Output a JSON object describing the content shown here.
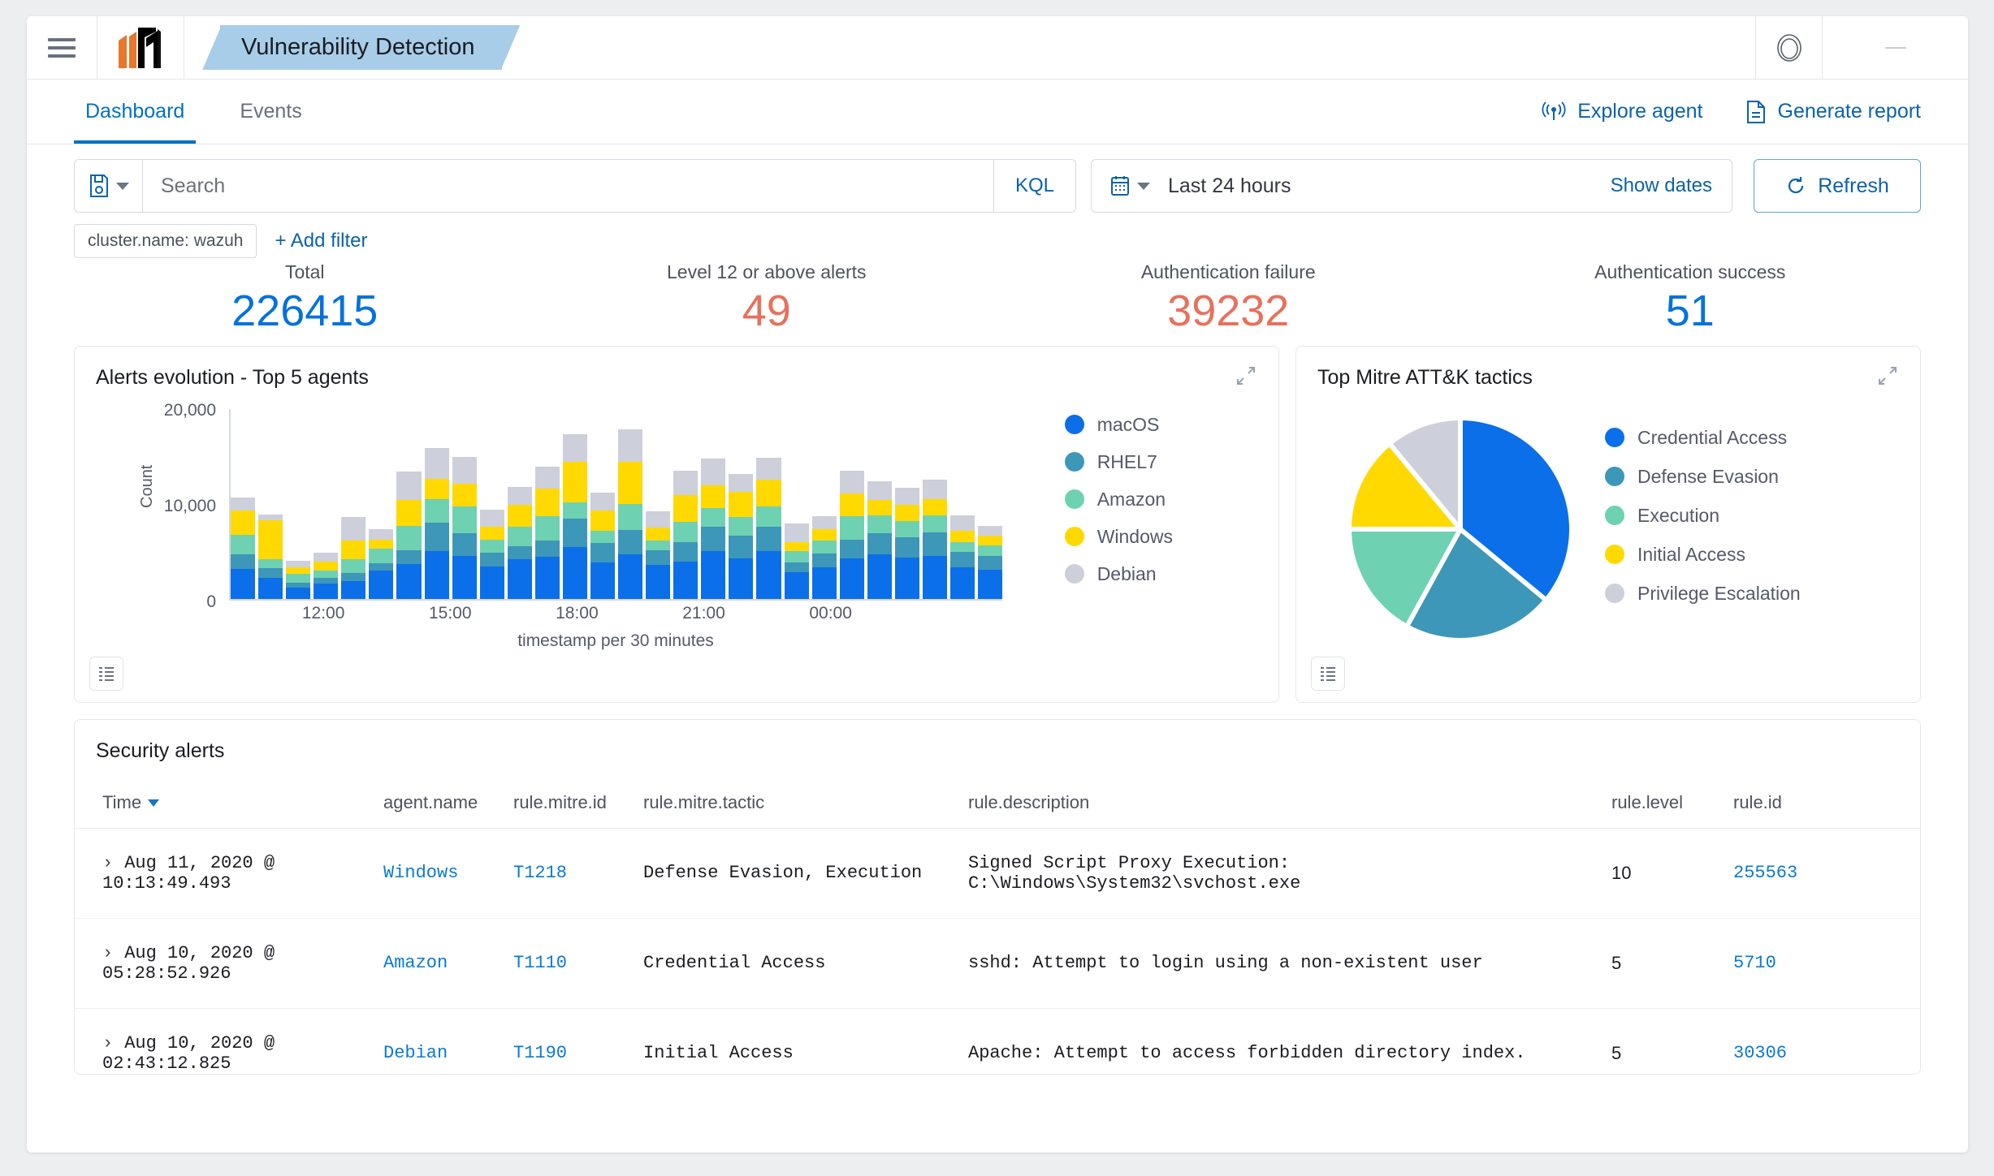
{
  "header": {
    "app_title": "Vulnerability Detection",
    "menu_icon": "hamburger-menu-icon",
    "logo_icon": "wazuh-logo-icon",
    "account_icon": "account-circle-icon"
  },
  "nav": {
    "tabs": [
      {
        "label": "Dashboard",
        "active": true
      },
      {
        "label": "Events",
        "active": false
      }
    ],
    "actions": [
      {
        "label": "Explore agent",
        "icon": "agent-signal-icon"
      },
      {
        "label": "Generate report",
        "icon": "document-report-icon"
      }
    ]
  },
  "search": {
    "placeholder": "Search",
    "value": "",
    "dataview_icon": "saved-query-icon",
    "language": "KQL",
    "date_icon": "calendar-icon",
    "date_range": "Last 24 hours",
    "show_dates": "Show dates",
    "refresh": "Refresh",
    "refresh_icon": "refresh-icon"
  },
  "filters": {
    "pills": [
      "cluster.name: wazuh"
    ],
    "add_filter": "+ Add filter"
  },
  "kpis": [
    {
      "label": "Total",
      "value": "226415",
      "color": "blue"
    },
    {
      "label": "Level 12 or above alerts",
      "value": "49",
      "color": "red"
    },
    {
      "label": "Authentication failure",
      "value": "39232",
      "color": "red"
    },
    {
      "label": "Authentication success",
      "value": "51",
      "color": "blue"
    }
  ],
  "panels": {
    "bar": {
      "title": "Alerts evolution - Top 5 agents",
      "expand_icon": "expand-icon",
      "footer_icon": "inspect-data-icon"
    },
    "pie": {
      "title": "Top Mitre ATT&K tactics",
      "expand_icon": "expand-icon",
      "footer_icon": "inspect-data-icon"
    }
  },
  "chart_data": [
    {
      "type": "bar",
      "title": "Alerts evolution - Top 5 agents",
      "xlabel": "timestamp per 30 minutes",
      "ylabel": "Count",
      "ylim": [
        0,
        20000
      ],
      "yticks": [
        "0",
        "10,000",
        "20,000"
      ],
      "xticks": [
        "12:00",
        "15:00",
        "18:00",
        "21:00",
        "00:00"
      ],
      "xtick_positions_pct": [
        12.2,
        28.6,
        45.0,
        61.4,
        77.8
      ],
      "grid": false,
      "legend_position": "right",
      "stacked": true,
      "colors": {
        "macOS": "#0a6fe8",
        "RHEL7": "#3d97b8",
        "Amazon": "#6ed1b2",
        "Windows": "#ffd900",
        "Debian": "#cdd0da"
      },
      "series": [
        {
          "name": "macOS",
          "values": [
            3100,
            2200,
            1200,
            1600,
            1800,
            2900,
            3600,
            5000,
            4500,
            3400,
            4100,
            4400,
            5400,
            3800,
            4600,
            3500,
            3900,
            5000,
            4200,
            5000,
            2800,
            3300,
            4200,
            4600,
            4300,
            4500,
            3300,
            3000
          ]
        },
        {
          "name": "RHEL7",
          "values": [
            1500,
            1000,
            500,
            600,
            900,
            800,
            1500,
            2900,
            2300,
            1400,
            1400,
            1700,
            3000,
            2000,
            2600,
            1600,
            2000,
            2500,
            2400,
            2500,
            1000,
            1400,
            2000,
            2200,
            2100,
            2400,
            1600,
            1500
          ]
        },
        {
          "name": "Amazon",
          "values": [
            2100,
            900,
            900,
            700,
            1400,
            1500,
            2500,
            2500,
            2800,
            1400,
            2000,
            2500,
            1700,
            1300,
            2700,
            1000,
            2100,
            2000,
            1900,
            2100,
            1200,
            1400,
            2400,
            1900,
            1700,
            1800,
            1000,
            1100
          ]
        },
        {
          "name": "Windows",
          "values": [
            2500,
            4100,
            700,
            1000,
            2000,
            1000,
            2700,
            2100,
            2400,
            1300,
            2300,
            2900,
            4200,
            2100,
            4400,
            1300,
            2800,
            2300,
            2700,
            2800,
            900,
            1200,
            2400,
            1600,
            1700,
            1700,
            1200,
            1000
          ]
        },
        {
          "name": "Debian",
          "values": [
            1400,
            600,
            700,
            900,
            2400,
            1100,
            3000,
            3200,
            2800,
            1800,
            1900,
            2300,
            2900,
            1900,
            3400,
            1700,
            2600,
            2800,
            1800,
            2300,
            2000,
            1300,
            2400,
            2000,
            1800,
            2000,
            1600,
            1000
          ]
        }
      ]
    },
    {
      "type": "pie",
      "title": "Top Mitre ATT&K tactics",
      "legend_position": "right",
      "labels": [
        "Credential Access",
        "Defense Evasion",
        "Execution",
        "Initial Access",
        "Privilege Escalation"
      ],
      "values": [
        36,
        22,
        17,
        14,
        11
      ],
      "colors": [
        "#0a6fe8",
        "#3d97b8",
        "#6ed1b2",
        "#ffd900",
        "#cdd0da"
      ]
    }
  ],
  "table": {
    "title": "Security alerts",
    "columns": [
      "Time",
      "agent.name",
      "rule.mitre.id",
      "rule.mitre.tactic",
      "rule.description",
      "rule.level",
      "rule.id"
    ],
    "sorted_by": "Time",
    "rows": [
      {
        "time": "Aug 11, 2020 @ 10:13:49.493",
        "agent": "Windows",
        "mitre_id": "T1218",
        "tactic": "Defense Evasion, Execution",
        "description": "Signed Script Proxy Execution: C:\\Windows\\System32\\svchost.exe",
        "level": "10",
        "rule_id": "255563"
      },
      {
        "time": "Aug 10, 2020 @ 05:28:52.926",
        "agent": "Amazon",
        "mitre_id": "T1110",
        "tactic": "Credential Access",
        "description": "sshd: Attempt to login using a non-existent user",
        "level": "5",
        "rule_id": "5710"
      },
      {
        "time": "Aug 10, 2020 @ 02:43:12.825",
        "agent": "Debian",
        "mitre_id": "T1190",
        "tactic": "Initial Access",
        "description": "Apache: Attempt to access forbidden directory index.",
        "level": "5",
        "rule_id": "30306"
      }
    ]
  }
}
